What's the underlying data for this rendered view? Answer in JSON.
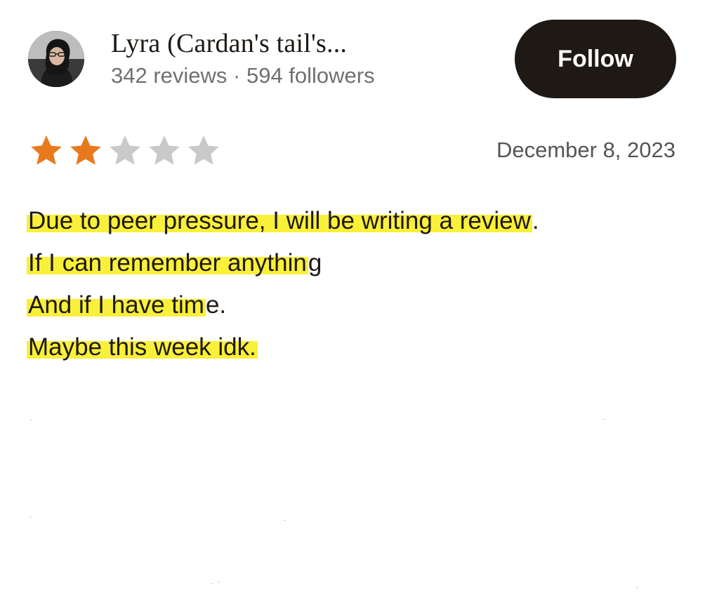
{
  "reviewer": {
    "name": "Lyra (Cardan's tail's...",
    "stats": "342 reviews · 594 followers",
    "avatar_icon": "user-avatar-photo"
  },
  "follow_button": {
    "label": "Follow"
  },
  "review": {
    "rating": 2,
    "rating_max": 5,
    "star_filled_color": "#e87a1e",
    "star_empty_color": "#c9c9c9",
    "date": "December 8, 2023",
    "highlight_color": "#f9f03a",
    "lines": [
      {
        "highlighted": "Due to peer pressure, I will be writing a review",
        "rest": "."
      },
      {
        "highlighted": "If I can remember anythin",
        "rest": "g"
      },
      {
        "highlighted": "And if I have tim",
        "rest": "e."
      },
      {
        "highlighted": "Maybe this week idk.",
        "rest": ""
      }
    ]
  }
}
